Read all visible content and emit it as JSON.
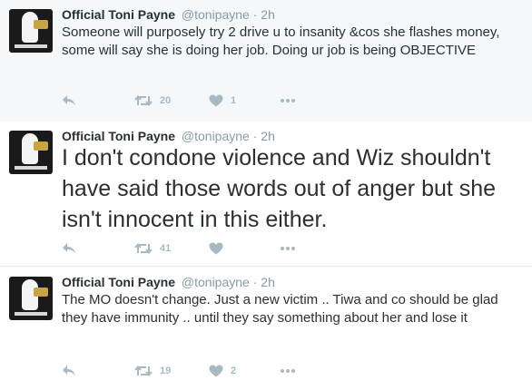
{
  "tweets": [
    {
      "name": "Official Toni Payne",
      "handle": "@tonipayne",
      "separator": "·",
      "time": "2h",
      "text": "Someone will purposely try 2 drive u to insanity &cos she flashes money, some will say she is doing her job. Doing ur job is being OBJECTIVE",
      "retweets": "20",
      "likes": "1"
    },
    {
      "name": "Official Toni Payne",
      "handle": "@tonipayne",
      "separator": "·",
      "time": "2h",
      "text": "I don't condone violence and Wiz shouldn't have said those words out of anger but she isn't innocent in this either.",
      "retweets": "41",
      "likes": ""
    },
    {
      "name": "Official Toni Payne",
      "handle": "@tonipayne",
      "separator": "·",
      "time": "2h",
      "text": "The MO doesn't change. Just a new victim .. Tiwa and co should be glad they have immunity .. until they say something about her and lose it",
      "retweets": "19",
      "likes": "2"
    }
  ],
  "icons": {
    "reply": "reply-icon",
    "retweet": "retweet-icon",
    "like": "heart-icon",
    "more": "more-dots-icon"
  },
  "colors": {
    "name": "#292f33",
    "muted": "#8899a6",
    "action": "#aab8c2",
    "highlight_bg": "#f5f8fa"
  }
}
